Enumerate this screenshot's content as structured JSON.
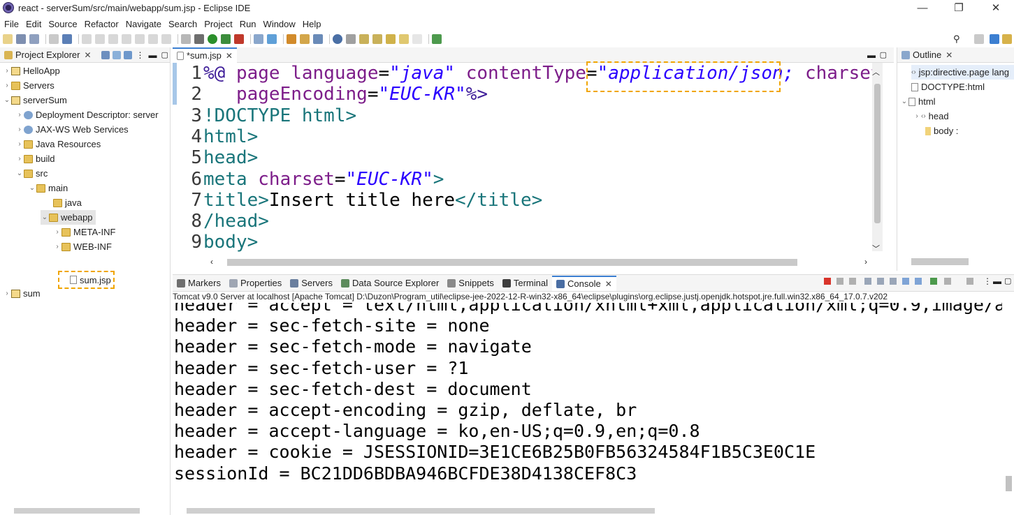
{
  "window": {
    "title": "react - serverSum/src/main/webapp/sum.jsp - Eclipse IDE",
    "minimize": "—",
    "maximize": "❐",
    "close": "✕"
  },
  "menu": [
    "File",
    "Edit",
    "Source",
    "Refactor",
    "Navigate",
    "Search",
    "Project",
    "Run",
    "Window",
    "Help"
  ],
  "project_explorer": {
    "tab_label": "Project Explorer",
    "close": "✕",
    "items": [
      {
        "label": "HelloApp",
        "arrow": "›",
        "icon": "project-icon"
      },
      {
        "label": "Servers",
        "arrow": "›",
        "icon": "folder-icon"
      },
      {
        "label": "serverSum",
        "arrow": "⌄",
        "icon": "project-icon"
      },
      {
        "label": "Deployment Descriptor: server",
        "arrow": "›",
        "icon": "gear-icon"
      },
      {
        "label": "JAX-WS Web Services",
        "arrow": "›",
        "icon": "gear-icon"
      },
      {
        "label": "Java Resources",
        "arrow": "›",
        "icon": "folder-icon"
      },
      {
        "label": "build",
        "arrow": "›",
        "icon": "folder-icon"
      },
      {
        "label": "src",
        "arrow": "⌄",
        "icon": "folder-icon"
      },
      {
        "label": "main",
        "arrow": "⌄",
        "icon": "folder-icon"
      },
      {
        "label": "java",
        "arrow": "",
        "icon": "folder-icon"
      },
      {
        "label": "webapp",
        "arrow": "⌄",
        "icon": "folder-icon"
      },
      {
        "label": "META-INF",
        "arrow": "›",
        "icon": "folder-icon"
      },
      {
        "label": "WEB-INF",
        "arrow": "›",
        "icon": "folder-icon"
      },
      {
        "label": "sum.jsp",
        "arrow": "",
        "icon": "file-icon"
      },
      {
        "label": "sum",
        "arrow": "›",
        "icon": "project-icon"
      }
    ]
  },
  "editor": {
    "tab_label": "*sum.jsp",
    "close": "✕",
    "lines": [
      {
        "num": "1",
        "parts": [
          [
            "kw",
            "%@ "
          ],
          [
            "attr",
            "page "
          ],
          [
            "attr",
            "language"
          ],
          [
            "txt",
            "="
          ],
          [
            "str",
            "\"java\""
          ],
          [
            "attr",
            " contentType"
          ],
          [
            "txt",
            "="
          ],
          [
            "str",
            "\"application/json; "
          ],
          [
            "attr",
            "charset"
          ],
          [
            "txt",
            "="
          ]
        ]
      },
      {
        "num": "2",
        "parts": [
          [
            "attr",
            "   pageEncoding"
          ],
          [
            "txt",
            "="
          ],
          [
            "str",
            "\"EUC-KR\""
          ],
          [
            "kw",
            "%>"
          ]
        ]
      },
      {
        "num": "3",
        "parts": [
          [
            "tag",
            "!DOCTYPE html>"
          ]
        ]
      },
      {
        "num": "4",
        "parts": [
          [
            "tag",
            "html>"
          ]
        ]
      },
      {
        "num": "5",
        "parts": [
          [
            "tag",
            "head>"
          ]
        ]
      },
      {
        "num": "6",
        "parts": [
          [
            "tag",
            "meta "
          ],
          [
            "attr",
            "charset"
          ],
          [
            "txt",
            "="
          ],
          [
            "str",
            "\"EUC-KR\""
          ],
          [
            "tag",
            ">"
          ]
        ]
      },
      {
        "num": "7",
        "parts": [
          [
            "tag",
            "title>"
          ],
          [
            "txt",
            "Insert title here"
          ],
          [
            "tag",
            "</title>"
          ]
        ]
      },
      {
        "num": "8",
        "parts": [
          [
            "tag",
            "/head>"
          ]
        ]
      },
      {
        "num": "9",
        "parts": [
          [
            "tag",
            "body>"
          ]
        ]
      }
    ]
  },
  "outline": {
    "tab_label": "Outline",
    "close": "✕",
    "items": [
      {
        "label": "jsp:directive.page lang",
        "arrow": ""
      },
      {
        "label": "DOCTYPE:html",
        "arrow": ""
      },
      {
        "label": "html",
        "arrow": "⌄"
      },
      {
        "label": "head",
        "arrow": "›"
      },
      {
        "label": "body :",
        "arrow": ""
      }
    ]
  },
  "console": {
    "tabs": [
      "Markers",
      "Properties",
      "Servers",
      "Data Source Explorer",
      "Snippets",
      "Terminal",
      "Console"
    ],
    "close": "✕",
    "status": "Tomcat v9.0 Server at localhost [Apache Tomcat] D:\\Duzon\\Program_util\\eclipse-jee-2022-12-R-win32-x86_64\\eclipse\\plugins\\org.eclipse.justj.openjdk.hotspot.jre.full.win32.x86_64_17.0.7.v202",
    "lines": [
      "header = accept = text/html,application/xhtml+xml,application/xml;q=0.9,image/a",
      "header = sec-fetch-site = none",
      "header = sec-fetch-mode = navigate",
      "header = sec-fetch-user = ?1",
      "header = sec-fetch-dest = document",
      "header = accept-encoding = gzip, deflate, br",
      "header = accept-language = ko,en-US;q=0.9,en;q=0.8",
      "header = cookie = JSESSIONID=3E1CE6B25B0FB56324584F1B5C3E0C1E",
      "sessionId = BC21DD6BDBA946BCFDE38D4138CEF8C3"
    ]
  },
  "colors": {
    "accent": "#3c7fd1",
    "highlight": "#f0a500"
  }
}
